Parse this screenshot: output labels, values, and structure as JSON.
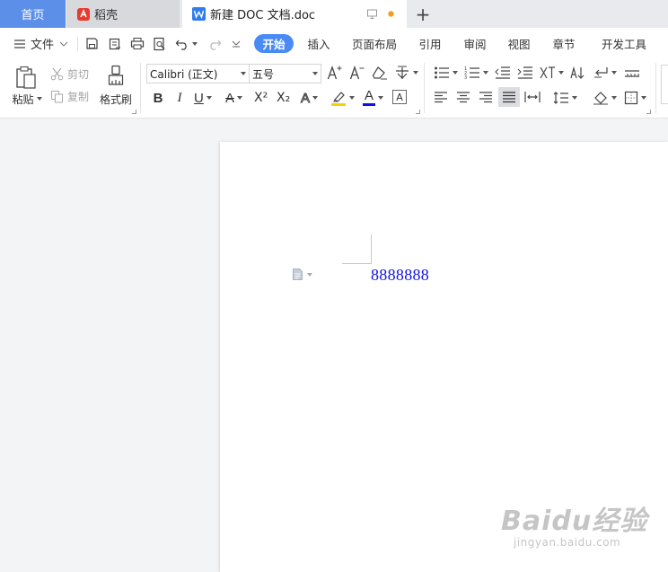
{
  "tabs": {
    "home": "首页",
    "daoke": "稻壳",
    "document": "新建 DOC 文档.doc",
    "add_symbol": "+"
  },
  "menubar": {
    "file_label": "文件",
    "tabs": [
      "开始",
      "插入",
      "页面布局",
      "引用",
      "审阅",
      "视图",
      "章节",
      "开发工具"
    ],
    "active_tab": "开始"
  },
  "ribbon": {
    "paste": "粘贴",
    "cut": "剪切",
    "copy": "复制",
    "format_painter": "格式刷",
    "font_name": "Calibri (正文)",
    "font_size": "五号",
    "bold": "B",
    "italic": "I",
    "underline": "U",
    "strikethrough": "A",
    "superscript": "X²",
    "subscript": "X₂",
    "text_effect": "A",
    "font_color_letter": "A",
    "char_border": "A"
  },
  "colors": {
    "accent": "#4a8af4",
    "home_tab": "#5b8fe8",
    "highlight": "#f5d400",
    "font_color": "#1010ee",
    "doc_text": "#1010ee",
    "unsaved_dot": "#f0a020"
  },
  "document": {
    "body_text": "8888888"
  },
  "watermark": {
    "main": "Baidu经验",
    "sub": "jingyan.baidu.com"
  }
}
